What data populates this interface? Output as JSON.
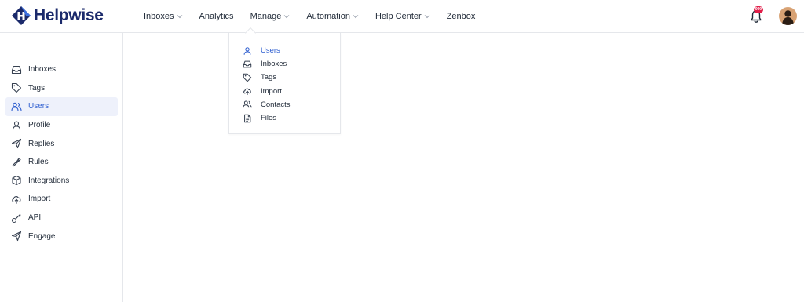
{
  "brand": {
    "name": "Helpwise",
    "color": "#1b2a6b"
  },
  "accent_color": "#2f5fd0",
  "nav": {
    "items": [
      {
        "label": "Inboxes",
        "has_dropdown": true
      },
      {
        "label": "Analytics",
        "has_dropdown": false
      },
      {
        "label": "Manage",
        "has_dropdown": true
      },
      {
        "label": "Automation",
        "has_dropdown": true
      },
      {
        "label": "Help Center",
        "has_dropdown": true
      },
      {
        "label": "Zenbox",
        "has_dropdown": false
      }
    ]
  },
  "notifications": {
    "badge": "999",
    "icon": "bell-icon",
    "badge_color": "#e11d48"
  },
  "user": {
    "avatar_icon": "avatar"
  },
  "manage_menu": {
    "items": [
      {
        "label": "Users",
        "icon": "user-icon",
        "active": true
      },
      {
        "label": "Inboxes",
        "icon": "inbox-icon",
        "active": false
      },
      {
        "label": "Tags",
        "icon": "tag-icon",
        "active": false
      },
      {
        "label": "Import",
        "icon": "cloud-upload-icon",
        "active": false
      },
      {
        "label": "Contacts",
        "icon": "contacts-icon",
        "active": false
      },
      {
        "label": "Files",
        "icon": "file-icon",
        "active": false
      }
    ]
  },
  "sidebar": {
    "items": [
      {
        "label": "Inboxes",
        "icon": "inbox-icon",
        "active": false
      },
      {
        "label": "Tags",
        "icon": "tag-icon",
        "active": false
      },
      {
        "label": "Users",
        "icon": "users-icon",
        "active": true
      },
      {
        "label": "Profile",
        "icon": "user-icon",
        "active": false
      },
      {
        "label": "Replies",
        "icon": "send-icon",
        "active": false
      },
      {
        "label": "Rules",
        "icon": "wrench-icon",
        "active": false
      },
      {
        "label": "Integrations",
        "icon": "cube-icon",
        "active": false
      },
      {
        "label": "Import",
        "icon": "cloud-upload-icon",
        "active": false
      },
      {
        "label": "API",
        "icon": "key-icon",
        "active": false
      },
      {
        "label": "Engage",
        "icon": "send-icon",
        "active": false
      }
    ]
  }
}
